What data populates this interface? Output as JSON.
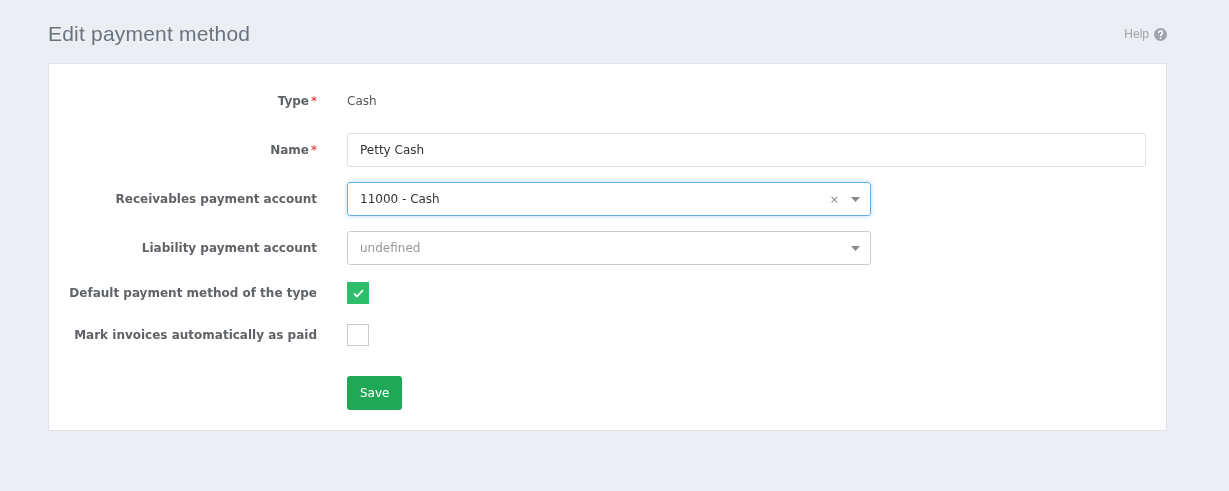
{
  "page": {
    "title": "Edit payment method",
    "help": "Help"
  },
  "fields": [
    {
      "kind": "static",
      "label": "Type",
      "required_mark": "*",
      "value": "Cash"
    },
    {
      "kind": "input",
      "label": "Name",
      "required_mark": "*",
      "value": "Petty Cash"
    },
    {
      "kind": "select",
      "label": "Receivables payment account",
      "value": "11000 - Cash",
      "clear": "×",
      "focused": true
    },
    {
      "kind": "select",
      "label": "Liability payment account",
      "placeholder": "undefined",
      "focused": false
    },
    {
      "kind": "checkbox",
      "label": "Default payment method of the type",
      "checked": true
    },
    {
      "kind": "checkbox",
      "label": "Mark invoices automatically as paid",
      "checked": false
    }
  ],
  "save": "Save"
}
